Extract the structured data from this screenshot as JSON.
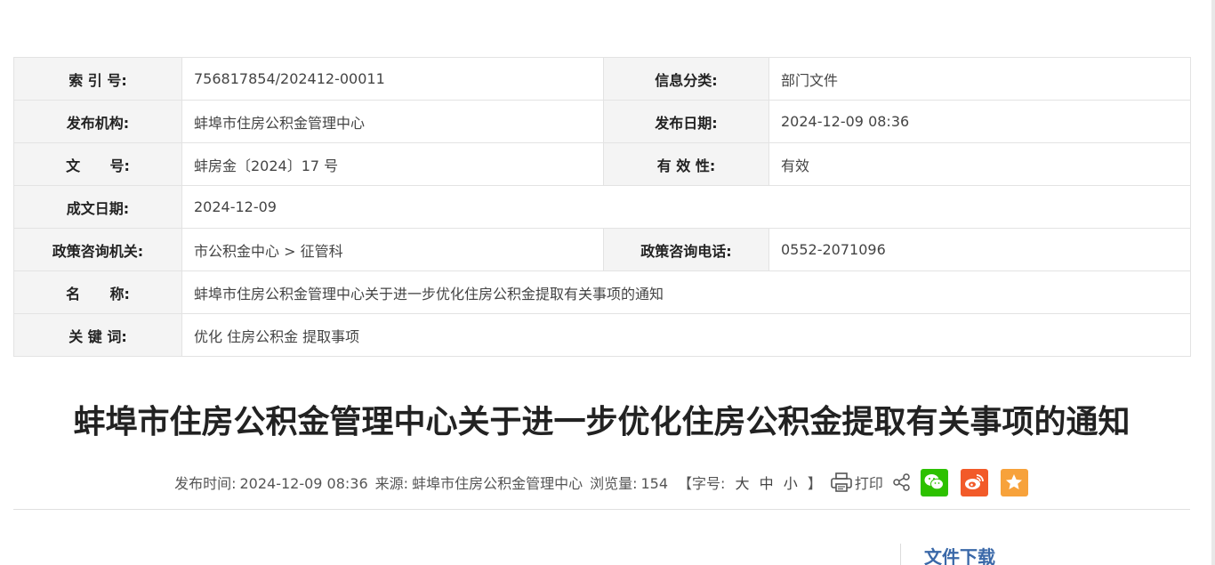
{
  "meta": {
    "index_no": {
      "label": "索 引 号:",
      "value": "756817854/202412-00011"
    },
    "info_category": {
      "label": "信息分类:",
      "value": "部门文件"
    },
    "publisher": {
      "label": "发布机构:",
      "value": "蚌埠市住房公积金管理中心"
    },
    "publish_date": {
      "label": "发布日期:",
      "value": "2024-12-09 08:36"
    },
    "doc_no": {
      "label": "文      号:",
      "value": "蚌房金〔2024〕17 号"
    },
    "validity": {
      "label": "有 效 性:",
      "value": "有效"
    },
    "written_date": {
      "label": "成文日期:",
      "value": "2024-12-09"
    },
    "consult_org": {
      "label": "政策咨询机关:",
      "value": "市公积金中心 > 征管科"
    },
    "consult_phone": {
      "label": "政策咨询电话:",
      "value": "0552-2071096"
    },
    "name": {
      "label": "名      称:",
      "value": "蚌埠市住房公积金管理中心关于进一步优化住房公积金提取有关事项的通知"
    },
    "keywords": {
      "label": "关 键 词:",
      "value": "优化 住房公积金 提取事项"
    }
  },
  "article": {
    "title": "蚌埠市住房公积金管理中心关于进一步优化住房公积金提取有关事项的通知"
  },
  "info_bar": {
    "publish_time_label": "发布时间:",
    "publish_time": "2024-12-09 08:36",
    "source_label": "来源:",
    "source": "蚌埠市住房公积金管理中心",
    "views_label": "浏览量:",
    "views": "154",
    "font_size_open": "【字号:",
    "font_large": "大",
    "font_medium": "中",
    "font_small": "小",
    "font_size_close": "】",
    "print_label": "打印",
    "icons": {
      "print": "printer-icon",
      "share": "share-icon",
      "wechat": "wechat-icon",
      "weibo": "weibo-icon",
      "favorite": "star-icon"
    },
    "colors": {
      "wechat": "#2dc100",
      "weibo": "#f25a29",
      "favorite": "#f7a23b"
    }
  },
  "download": {
    "title": "文件下载"
  }
}
